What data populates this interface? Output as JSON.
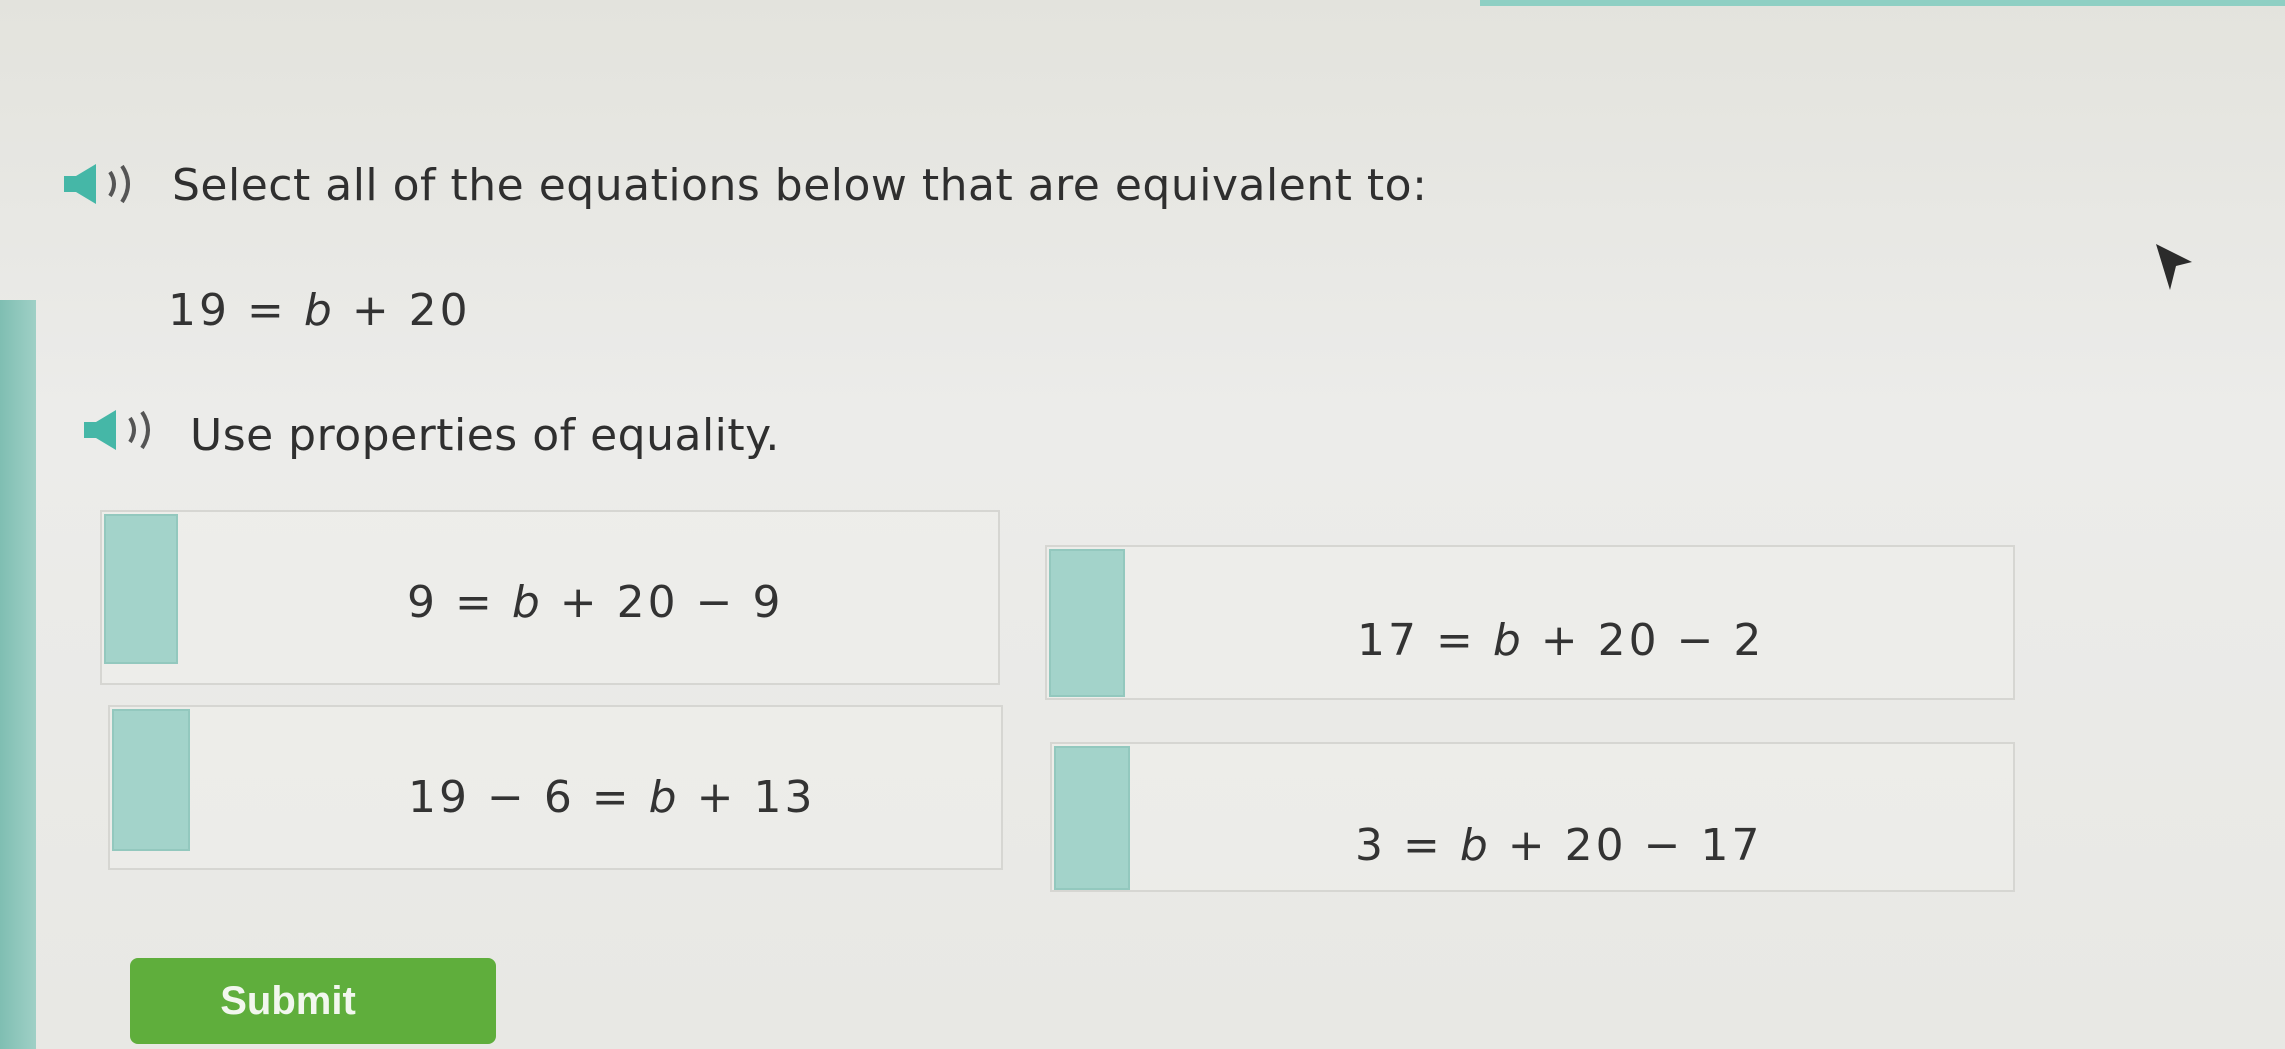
{
  "question": {
    "instruction": "Select all of the equations below that are equivalent to:",
    "target_equation": {
      "left": "19",
      "equals": "=",
      "variable": "b",
      "rest": "+ 20"
    },
    "hint": "Use properties of equality."
  },
  "choices": [
    {
      "id": "a",
      "before": "9 = ",
      "variable": "b",
      "after": " + 20 − 9"
    },
    {
      "id": "b",
      "before": "17 = ",
      "variable": "b",
      "after": " + 20 − 2"
    },
    {
      "id": "c",
      "before": "19 − 6 = ",
      "variable": "b",
      "after": " + 13"
    },
    {
      "id": "d",
      "before": "3 = ",
      "variable": "b",
      "after": " + 20 − 17"
    }
  ],
  "submit_label": "Submit",
  "icons": {
    "audio": "speaker-icon",
    "cursor": "mouse-pointer-icon"
  },
  "colors": {
    "accent_teal": "#a3d3ca",
    "submit_green": "#5fae3c"
  }
}
